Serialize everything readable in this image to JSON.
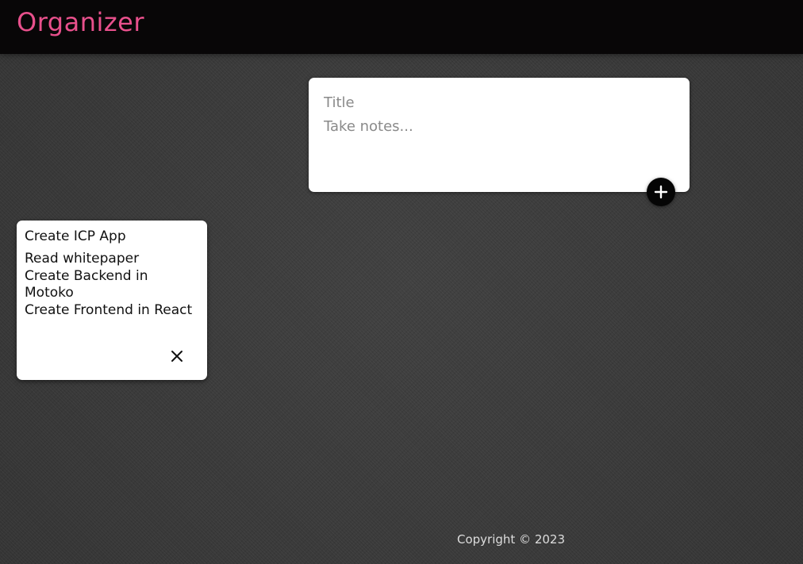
{
  "header": {
    "title": "Organizer",
    "title_color": "#e8508c"
  },
  "create_area": {
    "title_placeholder": "Title",
    "content_placeholder": "Take notes...",
    "add_icon": "plus-icon"
  },
  "notes": [
    {
      "title": "Create ICP App",
      "content": "Read whitepaper\nCreate Backend in Motoko\nCreate Frontend in React",
      "delete_icon": "close-icon"
    }
  ],
  "footer": {
    "text": "Copyright © 2023"
  }
}
